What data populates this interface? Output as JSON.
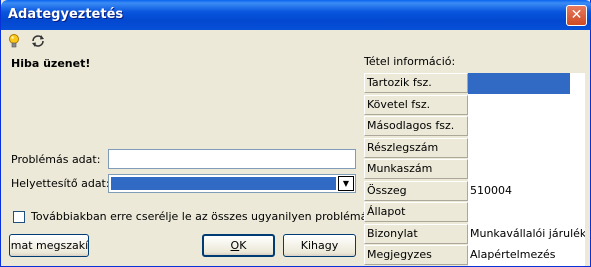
{
  "window": {
    "title": "Adategyeztetés",
    "close_symbol": "✕"
  },
  "toolbar": {
    "icons": [
      "lightbulb-icon",
      "refresh-icon"
    ]
  },
  "form": {
    "error_heading": "Hiba üzenet!",
    "problem_label": "Problémás adat:",
    "problem_value": "",
    "replacement_label": "Helyettesítő adat:",
    "replacement_value": "",
    "checkbox_label": "Továbbiakban erre cserélje le az összes ugyanilyen problémás tételt",
    "checkbox_checked": false
  },
  "buttons": {
    "abort_label": "amat megszakí",
    "ok_label": "OK",
    "ok_underline": "O",
    "ok_rest": "K",
    "skip_label": "Kihagy"
  },
  "item_info": {
    "title": "Tétel információ:",
    "rows": [
      {
        "key": "Tartozik fsz.",
        "value": "",
        "selected": true
      },
      {
        "key": "Követel fsz.",
        "value": ""
      },
      {
        "key": "Másodlagos fsz.",
        "value": ""
      },
      {
        "key": "Részlegszám",
        "value": ""
      },
      {
        "key": "Munkaszám",
        "value": ""
      },
      {
        "key": "Összeg",
        "value": "510004"
      },
      {
        "key": "Állapot",
        "value": ""
      },
      {
        "key": "Bizonylat",
        "value": "Munkavállalói járulék,"
      },
      {
        "key": "Megjegyzes",
        "value": "Alapértelmezés"
      }
    ]
  },
  "colors": {
    "titlebar": "#0855dd",
    "selection": "#316ac5",
    "face": "#ece9d8"
  }
}
